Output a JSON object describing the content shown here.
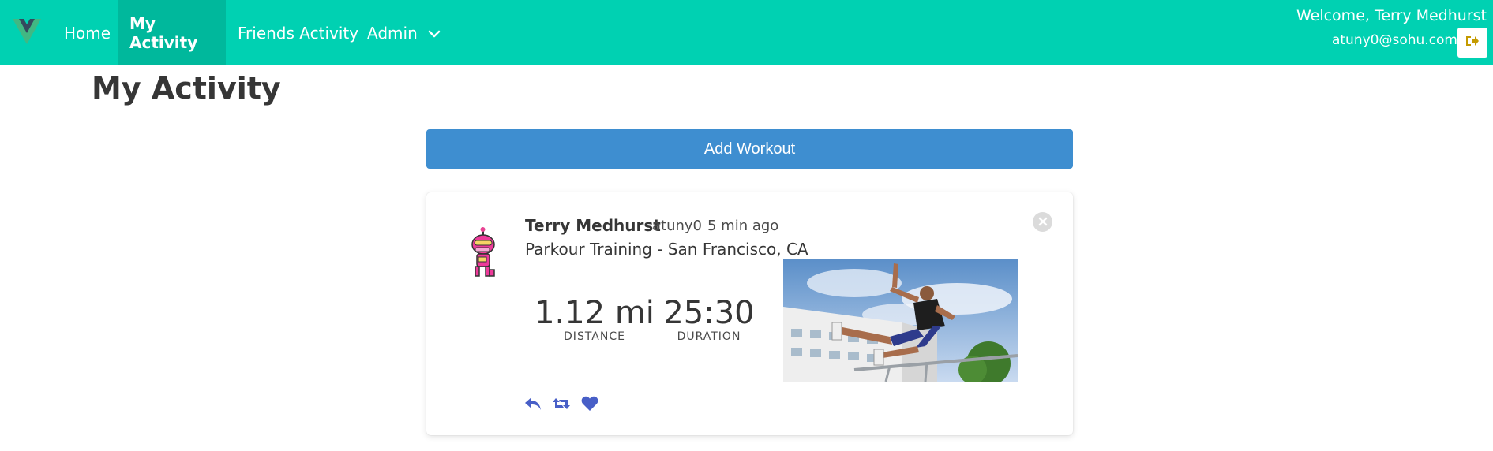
{
  "colors": {
    "navbar": "#00d1b2",
    "navbar_active": "#00b89c",
    "primary_button": "#3e8ed0",
    "action_icons": "#485fc7"
  },
  "navbar": {
    "logo_icon": "vue-logo-icon",
    "items": [
      {
        "label": "Home"
      },
      {
        "label": "My Activity"
      },
      {
        "label": "Friends Activity"
      },
      {
        "label": "Admin"
      }
    ],
    "admin_dropdown_icon": "chevron-down-icon",
    "welcome": "Welcome, Terry Medhurst",
    "email": "atuny0@sohu.com",
    "logout_icon": "sign-out-icon"
  },
  "page": {
    "title": "My Activity",
    "add_workout_label": "Add Workout"
  },
  "post": {
    "avatar_icon": "robot-avatar-icon",
    "name": "Terry Medhurst",
    "username": "atuny0",
    "time": "5 min ago",
    "title": "Parkour Training - San Francisco, CA",
    "distance_value": "1.12 mi",
    "distance_label": "DISTANCE",
    "duration_value": "25:30",
    "duration_label": "DURATION",
    "photo": "parkour-jump-photo",
    "actions": [
      "reply-icon",
      "retweet-icon",
      "heart-icon"
    ],
    "close_icon": "close-icon"
  }
}
